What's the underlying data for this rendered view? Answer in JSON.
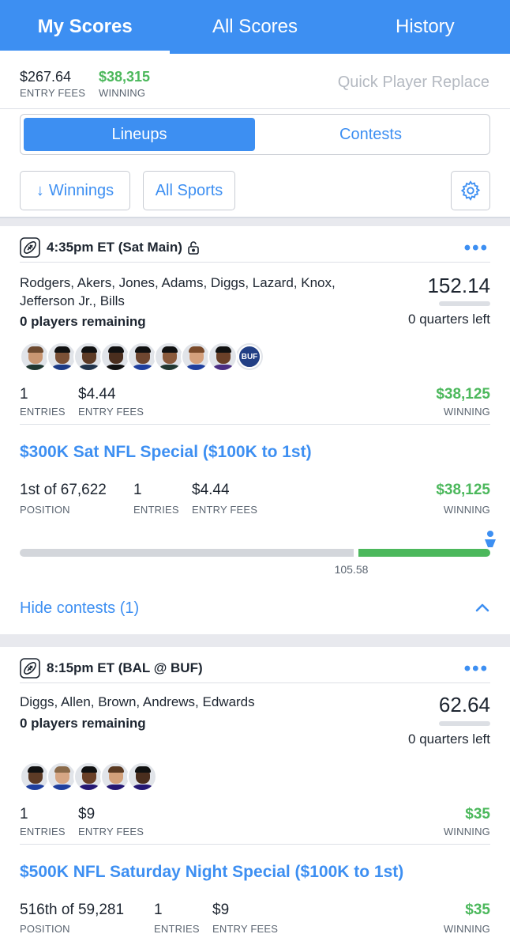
{
  "tabs": [
    {
      "label": "My Scores"
    },
    {
      "label": "All Scores"
    },
    {
      "label": "History"
    }
  ],
  "summary": {
    "entry_fees_value": "$267.64",
    "entry_fees_label": "ENTRY FEES",
    "winning_value": "$38,315",
    "winning_label": "WINNING",
    "quick_replace": "Quick Player Replace"
  },
  "segment": {
    "lineups": "Lineups",
    "contests": "Contests"
  },
  "filters": {
    "sort": "Winnings",
    "sport": "All Sports"
  },
  "lineups": [
    {
      "time": "4:35pm ET (Sat Main)",
      "players_line1": "Rodgers, Akers, Jones, Adams, Diggs, Lazard, Knox,",
      "players_line2": "Jefferson Jr., Bills",
      "remaining": "0 players remaining",
      "score": "152.14",
      "quarters": "0 quarters left",
      "team_logo": "BUF",
      "entries_value": "1",
      "entries_label": "ENTRIES",
      "fees_value": "$4.44",
      "fees_label": "ENTRY FEES",
      "winning_value": "$38,125",
      "winning_label": "WINNING",
      "contest": {
        "title": "$300K Sat NFL Special ($100K to 1st)",
        "position_value": "1st of 67,622",
        "position_label": "POSITION",
        "entries_value": "1",
        "entries_label": "ENTRIES",
        "fees_value": "$4.44",
        "fees_label": "ENTRY FEES",
        "winning_value": "$38,125",
        "winning_label": "WINNING",
        "progress_label": "105.58"
      },
      "hide_contests": "Hide contests (1)"
    },
    {
      "time": "8:15pm ET (BAL @ BUF)",
      "players_line1": "Diggs, Allen, Brown, Andrews, Edwards",
      "remaining": "0 players remaining",
      "score": "62.64",
      "quarters": "0 quarters left",
      "entries_value": "1",
      "entries_label": "ENTRIES",
      "fees_value": "$9",
      "fees_label": "ENTRY FEES",
      "winning_value": "$35",
      "winning_label": "WINNING",
      "contest": {
        "title": "$500K NFL Saturday Night Special ($100K to 1st)",
        "position_value": "516th of 59,281",
        "position_label": "POSITION",
        "entries_value": "1",
        "entries_label": "ENTRIES",
        "fees_value": "$9",
        "fees_label": "ENTRY FEES",
        "winning_value": "$35",
        "winning_label": "WINNING"
      }
    }
  ],
  "colors": {
    "accent": "#3d8ff2",
    "winning": "#4cb85c"
  }
}
